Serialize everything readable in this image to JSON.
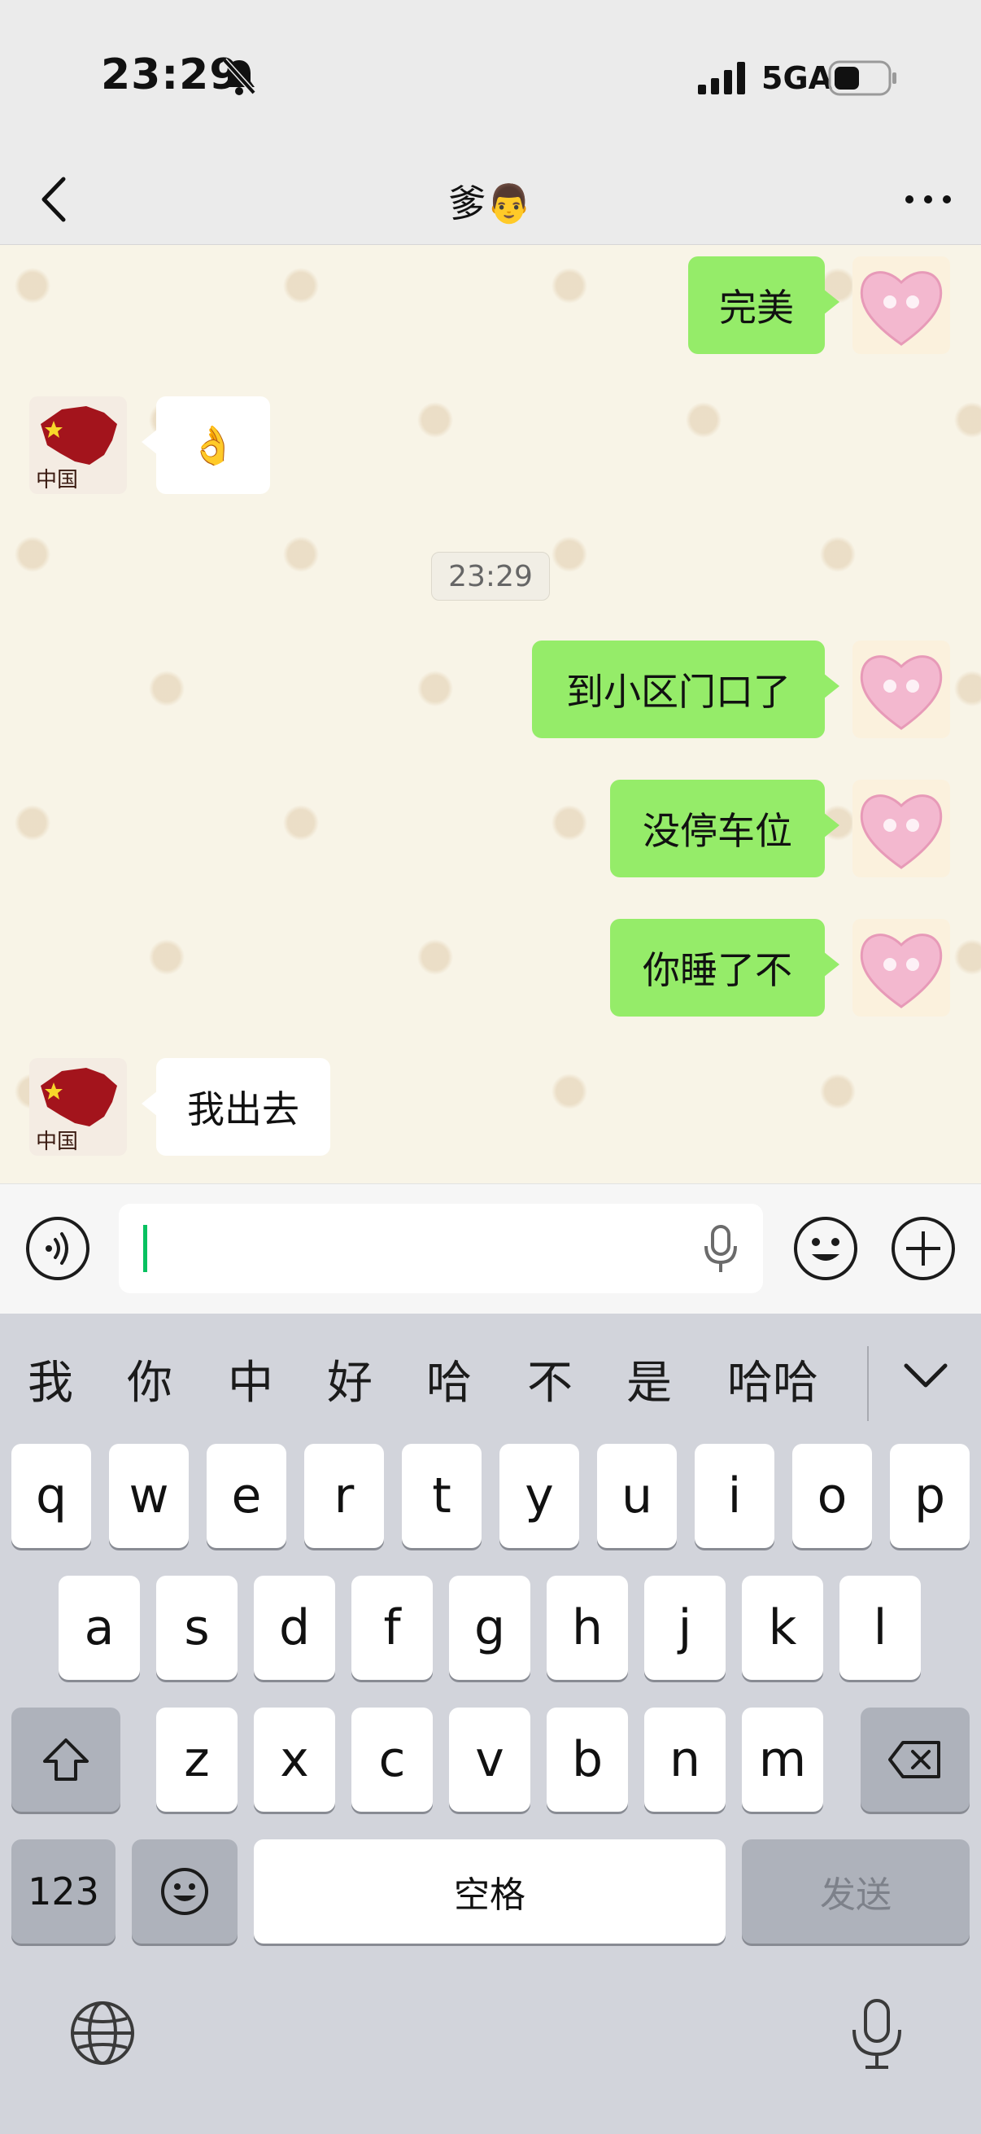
{
  "status_bar": {
    "time": "23:29",
    "network": "5GA",
    "icons": [
      "bell-slash-icon",
      "signal-icon",
      "battery-icon"
    ]
  },
  "nav": {
    "title": "爹👨",
    "icons": [
      "back-icon",
      "more-icon"
    ]
  },
  "messages": [
    {
      "from": "me",
      "text": "完美"
    },
    {
      "from": "them",
      "text": "👌"
    },
    {
      "type": "time",
      "text": "23:29"
    },
    {
      "from": "me",
      "text": "到小区门口了"
    },
    {
      "from": "me",
      "text": "没停车位"
    },
    {
      "from": "me",
      "text": "你睡了不"
    },
    {
      "from": "them",
      "text": "我出去"
    }
  ],
  "avatars": {
    "them_caption": "中国"
  },
  "input": {
    "value": "",
    "icons": [
      "voice-icon",
      "mic-icon",
      "emoji-icon",
      "plus-icon"
    ]
  },
  "keyboard": {
    "candidates": [
      "我",
      "你",
      "中",
      "好",
      "哈",
      "不",
      "是",
      "哈哈"
    ],
    "row1": [
      "q",
      "w",
      "e",
      "r",
      "t",
      "y",
      "u",
      "i",
      "o",
      "p"
    ],
    "row2": [
      "a",
      "s",
      "d",
      "f",
      "g",
      "h",
      "j",
      "k",
      "l"
    ],
    "row3": [
      "z",
      "x",
      "c",
      "v",
      "b",
      "n",
      "m"
    ],
    "num_label": "123",
    "space_label": "空格",
    "send_label": "发送",
    "colors": {
      "bubble_me": "#95ec69",
      "accent": "#07c160",
      "key_dark": "#aeb2bb"
    }
  }
}
